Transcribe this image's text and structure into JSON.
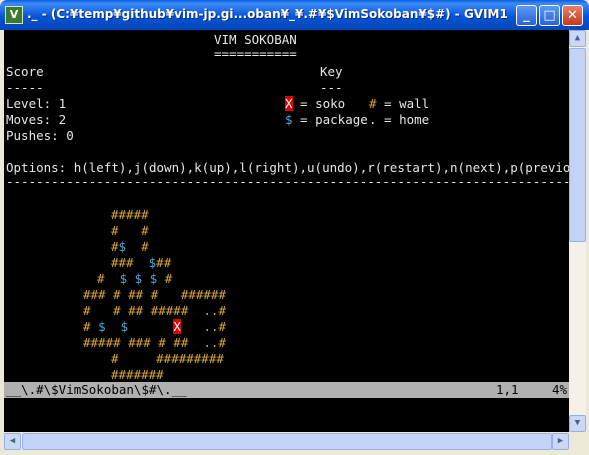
{
  "window": {
    "title": "._ - (C:¥temp¥github¥vim-jp.gi...oban¥_¥.#¥$VimSokoban¥$#) - GVIM1",
    "min_label": "_",
    "max_label": "□",
    "close_label": "✕"
  },
  "header": {
    "title": "VIM SOKOBAN",
    "underline": "==========="
  },
  "score": {
    "heading": "Score",
    "rule": "-----",
    "level": "Level: 1",
    "moves": "Moves: 2",
    "pushes": "Pushes: 0"
  },
  "key": {
    "heading": "Key",
    "rule": "---",
    "soko_symbol": "X",
    "soko_text": " = soko",
    "wall_symbol": "#",
    "wall_text": " = wall",
    "package_symbol": "$",
    "package_text": " = package",
    "home_symbol": ".",
    "home_text": " = home"
  },
  "options": "Options: h(left),j(down),k(up),l(right),u(undo),r(restart),n(next),p(previous)",
  "separator": "------------------------------------------------------------------------------------",
  "board": {
    "r1": {
      "a": "#####"
    },
    "r2": {
      "a": "#   #"
    },
    "r3": {
      "a": "#",
      "b": "$",
      "c": "  #"
    },
    "r4": {
      "a": "###  ",
      "b": "$",
      "c": "##"
    },
    "r5": {
      "a": "#  ",
      "b": "$",
      "c": " ",
      "d": "$",
      "e": " ",
      "f": "$",
      "g": " #"
    },
    "r6": {
      "a": "### # ## #   ######"
    },
    "r7": {
      "a": "#   # ## #####  ..#"
    },
    "r8": {
      "a": "# ",
      "b": "$",
      "c": "  ",
      "d": "$",
      "e": "      ",
      "x": "X",
      "f": "   ..#"
    },
    "r9": {
      "a": "##### ### # ##  ..#"
    },
    "r10": {
      "a": "#     #########"
    },
    "r11": {
      "a": "#######"
    }
  },
  "status": {
    "filename": "__\\.#\\$VimSokoban\\$#\\.__",
    "position": "1,1",
    "percent": "4%"
  },
  "colors": {
    "wall": "#d9a63a",
    "package": "#4fa8d6",
    "soko_bg": "#e00000",
    "status_bg": "#b0b0b0"
  }
}
